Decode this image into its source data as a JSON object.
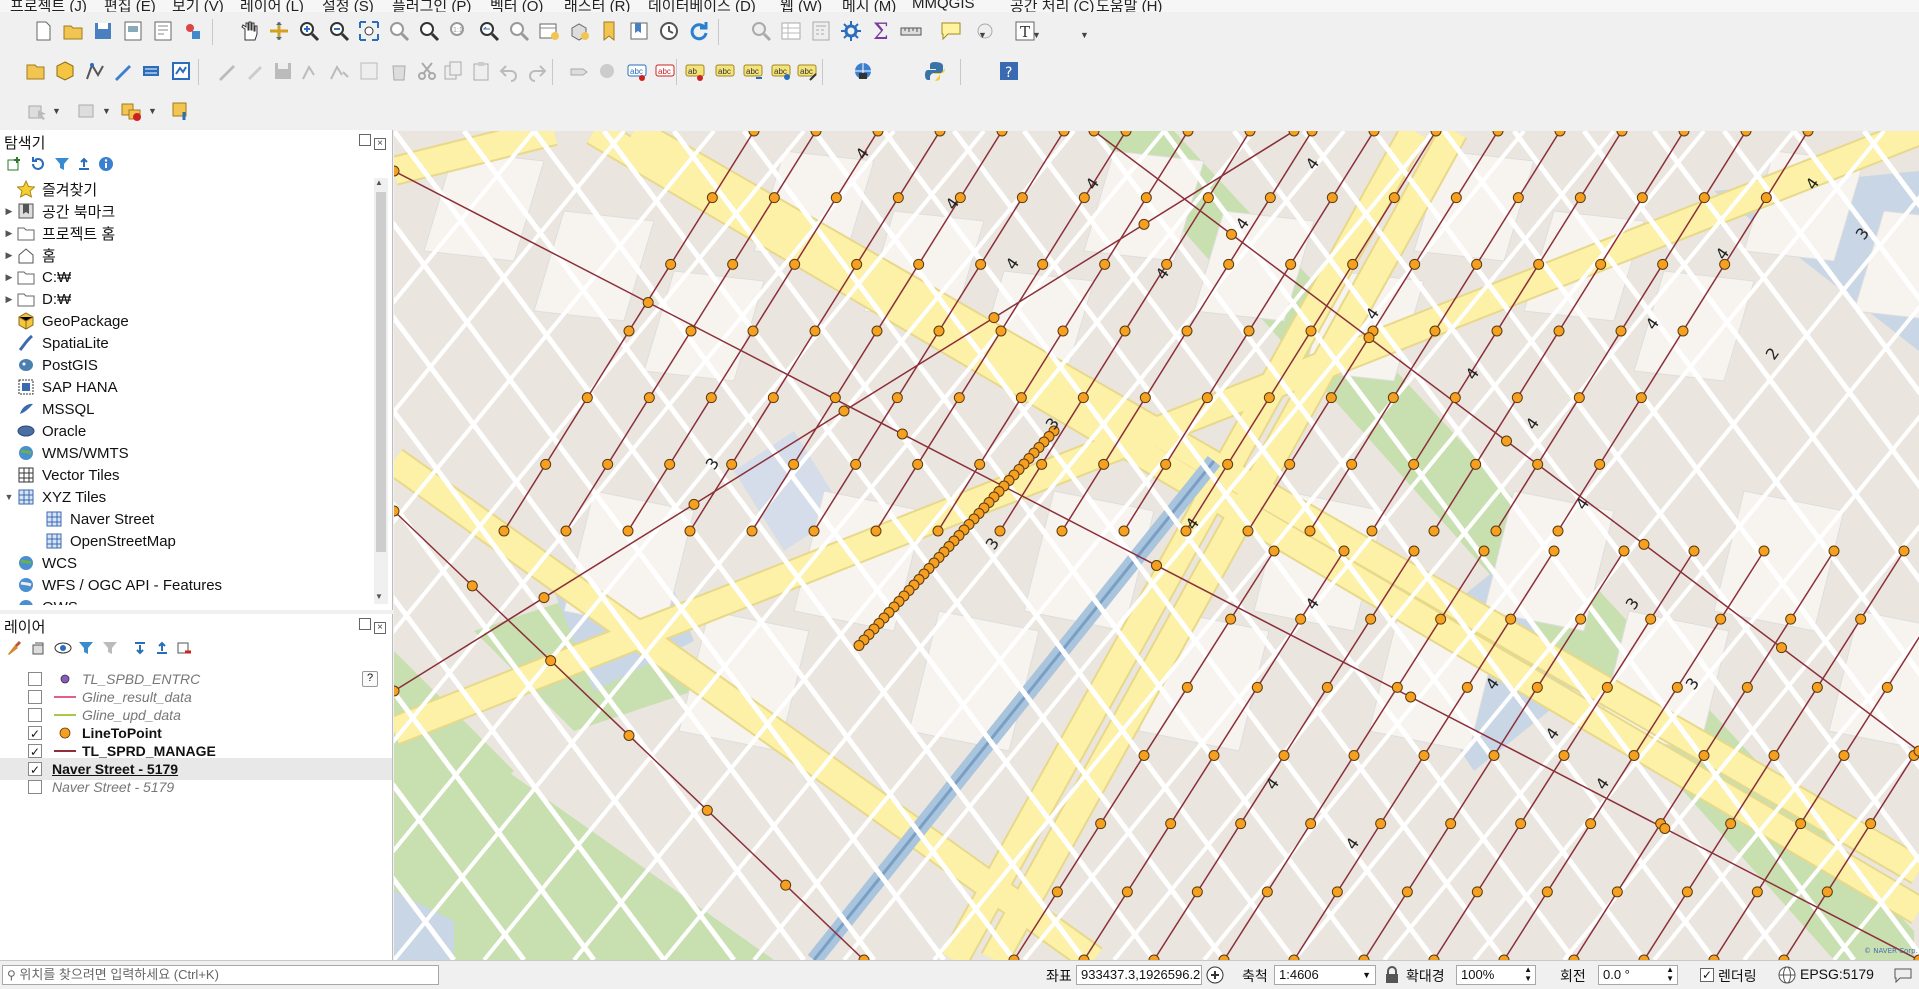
{
  "menubar": {
    "items": [
      "프로젝트 (J)",
      "편집 (E)",
      "보기 (V)",
      "레이어 (L)",
      "설정 (S)",
      "플러그인 (P)",
      "벡터 (O)",
      "래스터 (R)",
      "데이터베이스 (D)",
      "웹 (W)",
      "메시 (M)",
      "MMQGIS",
      "공간 처리 (C)",
      "도움말 (H)"
    ]
  },
  "browser": {
    "title": "탐색기",
    "items": [
      {
        "label": "즐겨찾기",
        "arrow": "",
        "icon": "star-icon"
      },
      {
        "label": "공간 북마크",
        "arrow": "▶",
        "icon": "bookmark-icon"
      },
      {
        "label": "프로젝트 홈",
        "arrow": "▶",
        "icon": "folder-icon"
      },
      {
        "label": "홈",
        "arrow": "▶",
        "icon": "home-icon"
      },
      {
        "label": "C:₩",
        "arrow": "▶",
        "icon": "folder-icon"
      },
      {
        "label": "D:₩",
        "arrow": "▶",
        "icon": "folder-icon"
      },
      {
        "label": "GeoPackage",
        "arrow": "",
        "icon": "geopackage-icon"
      },
      {
        "label": "SpatiaLite",
        "arrow": "",
        "icon": "spatialite-icon"
      },
      {
        "label": "PostGIS",
        "arrow": "",
        "icon": "postgis-icon"
      },
      {
        "label": "SAP HANA",
        "arrow": "",
        "icon": "sap-hana-icon"
      },
      {
        "label": "MSSQL",
        "arrow": "",
        "icon": "mssql-icon"
      },
      {
        "label": "Oracle",
        "arrow": "",
        "icon": "oracle-icon"
      },
      {
        "label": "WMS/WMTS",
        "arrow": "",
        "icon": "wms-icon"
      },
      {
        "label": "Vector Tiles",
        "arrow": "",
        "icon": "vector-tiles-icon"
      },
      {
        "label": "XYZ Tiles",
        "arrow": "▼",
        "icon": "xyz-tiles-icon"
      },
      {
        "label": "Naver Street",
        "arrow": "",
        "icon": "xyz-layer-icon",
        "indent": true
      },
      {
        "label": "OpenStreetMap",
        "arrow": "",
        "icon": "xyz-layer-icon",
        "indent": true
      },
      {
        "label": "WCS",
        "arrow": "",
        "icon": "wcs-icon"
      },
      {
        "label": "WFS / OGC API - Features",
        "arrow": "",
        "icon": "wfs-icon"
      },
      {
        "label": "OWS",
        "arrow": "",
        "icon": "ows-icon"
      }
    ]
  },
  "layers": {
    "title": "레이어",
    "items": [
      {
        "label": "TL_SPBD_ENTRC",
        "checked": false,
        "symbol": "point-purple",
        "style": "italic",
        "help": "?"
      },
      {
        "label": "Gline_result_data",
        "checked": false,
        "symbol": "line-pink",
        "style": "italic"
      },
      {
        "label": "Gline_upd_data",
        "checked": false,
        "symbol": "line-green",
        "style": "italic"
      },
      {
        "label": "LineToPoint",
        "checked": true,
        "symbol": "point-orange",
        "style": "bold"
      },
      {
        "label": "TL_SPRD_MANAGE",
        "checked": true,
        "symbol": "line-darkred",
        "style": "bold"
      },
      {
        "label": "Naver Street - 5179",
        "checked": true,
        "symbol": "none",
        "style": "bold-underline",
        "selected": true
      },
      {
        "label": "Naver Street - 5179",
        "checked": false,
        "symbol": "none",
        "style": "italic"
      }
    ],
    "check_mark": "✓"
  },
  "statusbar": {
    "search_placeholder": "위치를 찾으려면 입력하세요 (Ctrl+K)",
    "coord_label": "좌표",
    "coord_value": "933437.3,1926596.2",
    "scale_label": "축척",
    "scale_value": "1:4606",
    "magnifier_label": "확대경",
    "magnifier_value": "100%",
    "rotation_label": "회전",
    "rotation_value": "0.0 °",
    "render_label": "렌더링",
    "render_checked": "✓",
    "crs": "EPSG:5179"
  },
  "map": {
    "road_numbers": [
      "4",
      "4",
      "4",
      "4",
      "4",
      "4",
      "4",
      "4",
      "4",
      "4",
      "4",
      "4",
      "4",
      "4",
      "4",
      "4",
      "3",
      "3",
      "3",
      "3",
      "3",
      "3",
      "2",
      "4",
      "4",
      "4",
      "4",
      "4"
    ],
    "colors": {
      "background": "#eae6df",
      "block": "#f7f4ef",
      "major_road": "#fcf1a6",
      "major_road_edge": "#e8d88a",
      "green": "#c8dfb0",
      "water": "#c9d6e6",
      "line": "#8b2f3a",
      "point": "#f5a020",
      "point_edge": "#5a3a10"
    },
    "watermark": "© NAVER Corp."
  }
}
